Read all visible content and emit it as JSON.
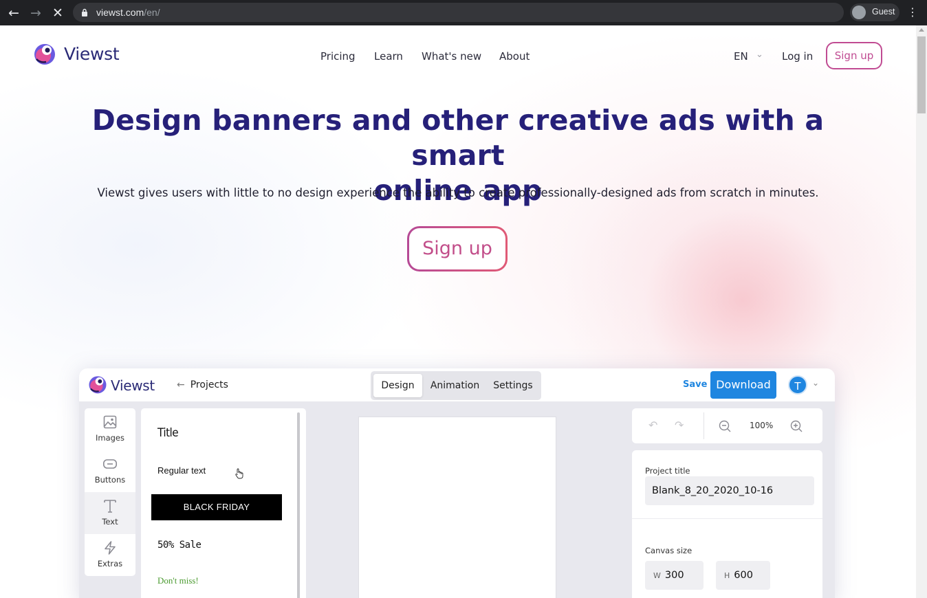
{
  "browser": {
    "url_host": "viewst.com",
    "url_path": "/en/",
    "profile_label": "Guest"
  },
  "header": {
    "brand": "Viewst",
    "nav": [
      "Pricing",
      "Learn",
      "What's new",
      "About"
    ],
    "language": "EN",
    "login_label": "Log in",
    "signup_label": "Sign up"
  },
  "hero": {
    "title_line1": "Design banners and other creative ads with a smart",
    "title_line2": "online app",
    "subtitle": "Viewst gives users with little to no design experience the ability to create professionally-designed ads from scratch in minutes.",
    "cta_label": "Sign up"
  },
  "app": {
    "brand": "Viewst",
    "back_label": "Projects",
    "tabs": [
      "Design",
      "Animation",
      "Settings"
    ],
    "active_tab": "Design",
    "save_label": "Save",
    "download_label": "Download",
    "avatar_initial": "T",
    "sidebar": [
      "Images",
      "Buttons",
      "Text",
      "Extras"
    ],
    "active_sidebar": "Text",
    "text_presets": {
      "title": "Title",
      "regular": "Regular text",
      "banner": "BLACK FRIDAY",
      "sale": "50% Sale",
      "miss": "Don't miss!"
    },
    "zoom": "100%",
    "project_title_label": "Project title",
    "project_title_value": "Blank_8_20_2020_10-16",
    "canvas_size_label": "Canvas size",
    "width_key": "W",
    "width_value": "300",
    "height_key": "H",
    "height_value": "600"
  },
  "colors": {
    "brand_navy": "#262079",
    "signup_pink": "#c04b92",
    "download_blue": "#1f86e0",
    "dont_miss_green": "#4a9a2f"
  }
}
